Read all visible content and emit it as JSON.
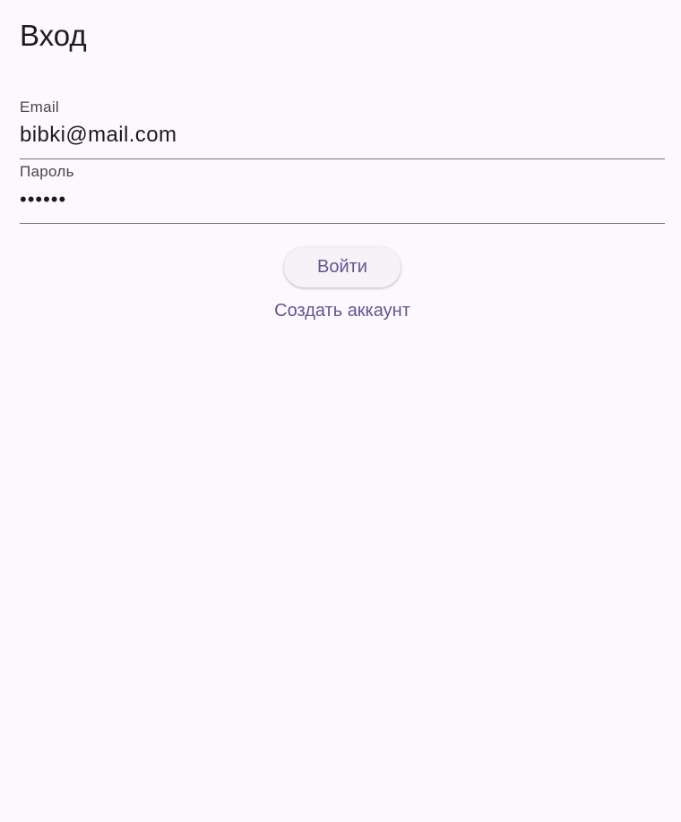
{
  "page": {
    "title": "Вход"
  },
  "form": {
    "email_label": "Email",
    "email_value": "bibki@mail.com",
    "password_label": "Пароль",
    "password_value": "••••••"
  },
  "actions": {
    "login_label": "Войти",
    "register_label": "Создать аккаунт"
  },
  "colors": {
    "accent": "#65558f",
    "background": "#fdf7fe",
    "underline": "#79747e"
  }
}
